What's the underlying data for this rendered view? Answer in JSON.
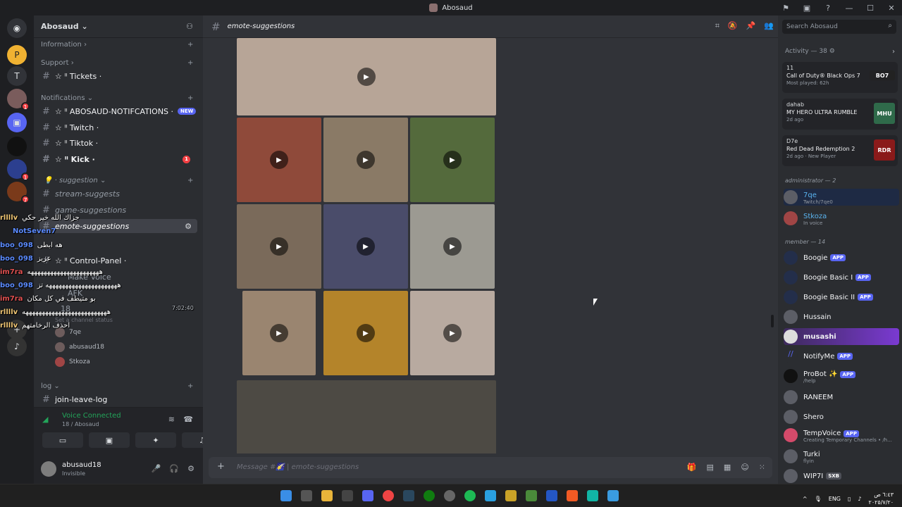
{
  "window": {
    "title": "Abosaud",
    "controls": [
      "⚑",
      "▣",
      "?",
      "—",
      "☐",
      "✕"
    ]
  },
  "guilds": {
    "icons": [
      "discord-logo",
      "server-p",
      "server-t",
      "server-avatar",
      "server-folder",
      "server-dark",
      "server-blue",
      "server-orange",
      "server-red",
      "server-music"
    ]
  },
  "server": {
    "name": "Abosaud ⌄"
  },
  "sidebar": {
    "categories": [
      {
        "label": "Information ›"
      },
      {
        "label": "Support ›"
      },
      {
        "label": "Notifications ⌄"
      },
      {
        "label": "· suggestion ⌄"
      },
      {
        "label": "log ⌄"
      }
    ],
    "channels": [
      {
        "label": "☆ ᴵᴵ Tickets ·"
      },
      {
        "label": "☆ ᴵᴵ ABOSAUD-NOTIFCATIONS ·",
        "badge": "NEW"
      },
      {
        "label": "☆ ᴵᴵ Twitch ·"
      },
      {
        "label": "☆ ᴵᴵ Tiktok ·"
      },
      {
        "label": "☆ ᴵᴵ Kick ·",
        "badge": "1"
      },
      {
        "label": "stream-suggests"
      },
      {
        "label": "game-suggestions"
      },
      {
        "label": "emote-suggestions"
      },
      {
        "label": "☆ ᴵᴵ Control-Panel ·"
      },
      {
        "label": "Make Voice"
      },
      {
        "label": "AFK"
      },
      {
        "label": "18"
      },
      {
        "label": "join-leave-log"
      }
    ],
    "voice_users": [
      "7qe",
      "abusaud18",
      "Stkoza"
    ],
    "voice_status": "Set a channel status"
  },
  "voice_panel": {
    "status": "Voice Connected",
    "channel": "18 / Abosaud"
  },
  "user": {
    "name": "abusaud18",
    "status": "Invisible"
  },
  "channel": {
    "name": "emote-suggestions",
    "placeholder": "Message #🌠 | emote-suggestions"
  },
  "search": {
    "placeholder": "Search Abosaud"
  },
  "activity": {
    "header": "Activity — 38 ⚙",
    "cards": [
      {
        "user": "11",
        "game": "Call of Duty® Black Ops 7",
        "sub": "Most played: 62h",
        "art": "BO7"
      },
      {
        "user": "dahab",
        "game": "MY HERO ULTRA RUMBLE",
        "sub": "2d ago",
        "art": "MHU"
      },
      {
        "user": "D7e",
        "game": "Red Dead Redemption 2",
        "sub": "2d ago · New Player",
        "art": "RDR"
      }
    ]
  },
  "members": {
    "admin_header": "administrator — 2",
    "admins": [
      {
        "name": "7qe",
        "sub": "Twitch/7qe0"
      },
      {
        "name": "Stkoza",
        "sub": "In voice"
      }
    ],
    "member_header": "member — 14",
    "list": [
      {
        "name": "Boogie",
        "app": "APP"
      },
      {
        "name": "Boogie Basic I",
        "app": "APP"
      },
      {
        "name": "Boogie Basic II",
        "app": "APP"
      },
      {
        "name": "Hussain"
      },
      {
        "name": "musashi"
      },
      {
        "name": "NotifyMe",
        "app": "APP"
      },
      {
        "name": "ProBot ✨",
        "app": "APP",
        "sub": "/help"
      },
      {
        "name": "RANEEM"
      },
      {
        "name": "Shero"
      },
      {
        "name": "TempVoice",
        "app": "APP",
        "sub": "Creating Temporary Channels • /h..."
      },
      {
        "name": "Turki",
        "sub": "flyin"
      },
      {
        "name": "WIP7I",
        "tag": "SXB"
      }
    ]
  },
  "chat_overlay": [
    {
      "name": "rllllv",
      "text": "جزاك الله خير حكي"
    },
    {
      "name": "NotSeven7",
      "text": ""
    },
    {
      "name": "boo_098",
      "text": "هه ابطى"
    },
    {
      "name": "boo_098",
      "text": "عزيز"
    },
    {
      "name": "im7ra",
      "text": "ههههههههههههههههههههههه"
    },
    {
      "name": "boo_098",
      "text": "ههههههههههههههههههههههه تز"
    },
    {
      "name": "im7ra",
      "text": "بو متيطف في كل مكان"
    },
    {
      "name": "rllllv",
      "text": "ههههههههههههههههههههههههههه"
    },
    {
      "name": "rllllv",
      "text": "احذف الرخامتهم"
    }
  ],
  "timestamp": "7:02:40",
  "tray": {
    "lang": "ENG",
    "time": "٦:٤٣ ص",
    "date": "٢٠٢٥/٧/٢٠"
  }
}
